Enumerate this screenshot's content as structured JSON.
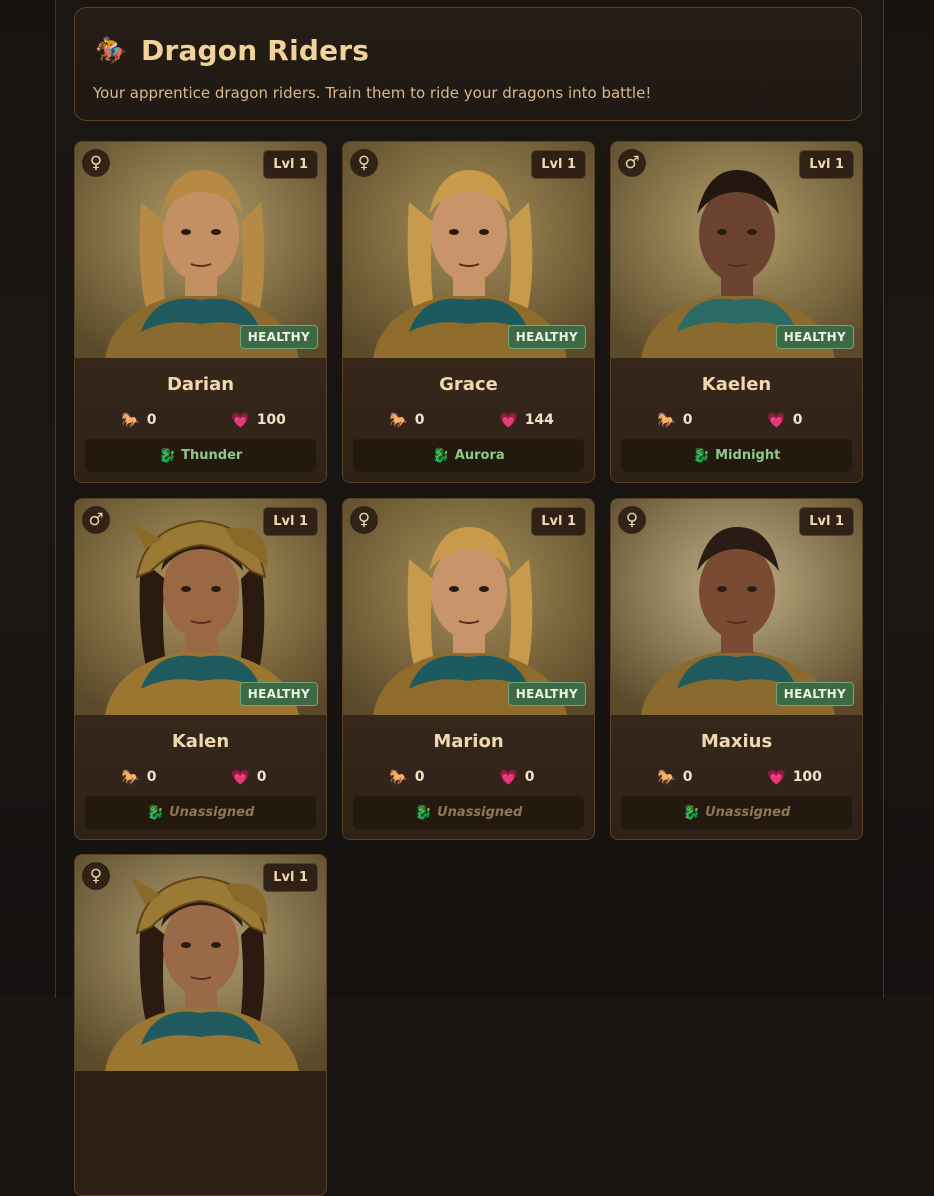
{
  "page": {
    "title": "Dragon Riders",
    "title_icon": "horse-rider-icon",
    "subtitle": "Your apprentice dragon riders. Train them to ride your dragons into battle!"
  },
  "icons": {
    "female": "♀",
    "male": "♂",
    "horse": "🐎",
    "heart": "💗",
    "dragon": "🐉",
    "rider": "🏇"
  },
  "colors": {
    "accent": "#f2d49a",
    "healthy": "#3d6a45",
    "assigned_dragon": "#8ec98a",
    "unassigned_dragon": "#8f7656"
  },
  "riders": [
    {
      "name": "Darian",
      "gender_symbol": "♀",
      "gender": "female",
      "level": "Lvl 1",
      "status": "HEALTHY",
      "riding": "0",
      "health": "100",
      "dragon": "Thunder",
      "assigned": true
    },
    {
      "name": "Grace",
      "gender_symbol": "♀",
      "gender": "female",
      "level": "Lvl 1",
      "status": "HEALTHY",
      "riding": "0",
      "health": "144",
      "dragon": "Aurora",
      "assigned": true
    },
    {
      "name": "Kaelen",
      "gender_symbol": "♂",
      "gender": "male",
      "level": "Lvl 1",
      "status": "HEALTHY",
      "riding": "0",
      "health": "0",
      "dragon": "Midnight",
      "assigned": true
    },
    {
      "name": "Kalen",
      "gender_symbol": "♂",
      "gender": "male",
      "level": "Lvl 1",
      "status": "HEALTHY",
      "riding": "0",
      "health": "0",
      "dragon": "Unassigned",
      "assigned": false
    },
    {
      "name": "Marion",
      "gender_symbol": "♀",
      "gender": "female",
      "level": "Lvl 1",
      "status": "HEALTHY",
      "riding": "0",
      "health": "0",
      "dragon": "Unassigned",
      "assigned": false
    },
    {
      "name": "Maxius",
      "gender_symbol": "♀",
      "gender": "female",
      "level": "Lvl 1",
      "status": "HEALTHY",
      "riding": "0",
      "health": "100",
      "dragon": "Unassigned",
      "assigned": false
    },
    {
      "name": "",
      "gender_symbol": "♀",
      "gender": "female",
      "level": "Lvl 1",
      "status": "",
      "riding": "",
      "health": "",
      "dragon": "",
      "assigned": false
    }
  ]
}
